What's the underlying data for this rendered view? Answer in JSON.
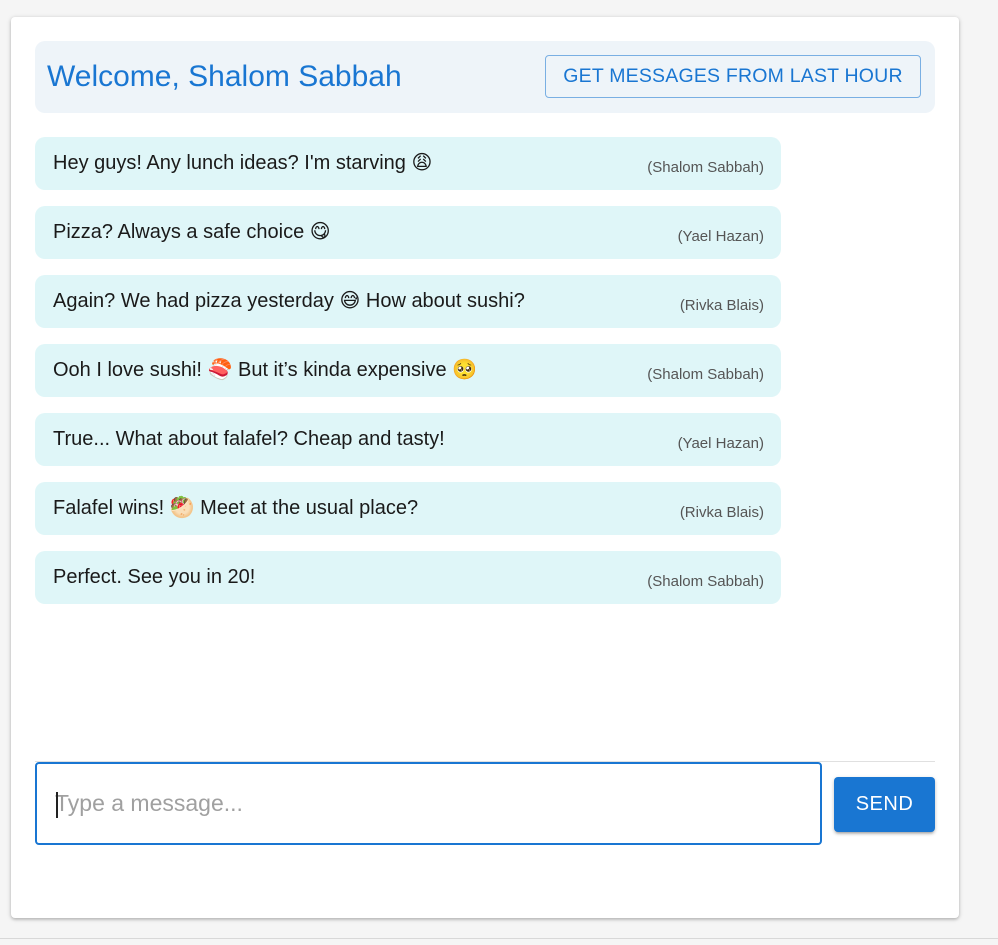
{
  "header": {
    "welcome": "Welcome, Shalom Sabbah",
    "last_hour_button": "GET MESSAGES FROM LAST HOUR"
  },
  "messages": [
    {
      "text": "Hey guys! Any lunch ideas? I'm starving 😩",
      "author": "(Shalom Sabbah)"
    },
    {
      "text": "Pizza? Always a safe choice 😋",
      "author": "(Yael Hazan)"
    },
    {
      "text": "Again? We had pizza yesterday 😅 How about sushi?",
      "author": "(Rivka Blais)"
    },
    {
      "text": "Ooh I love sushi! 🍣 But it’s kinda expensive 🥺",
      "author": "(Shalom Sabbah)"
    },
    {
      "text": "True... What about falafel? Cheap and tasty!",
      "author": "(Yael Hazan)"
    },
    {
      "text": "Falafel wins! 🥙 Meet at the usual place?",
      "author": "(Rivka Blais)"
    },
    {
      "text": "Perfect. See you in 20!",
      "author": "(Shalom Sabbah)"
    }
  ],
  "composer": {
    "placeholder": "Type a message...",
    "value": "",
    "send_label": "SEND"
  },
  "colors": {
    "primary": "#1976d2",
    "bubble": "#dff6f8",
    "header_bg": "#eef4f9"
  }
}
